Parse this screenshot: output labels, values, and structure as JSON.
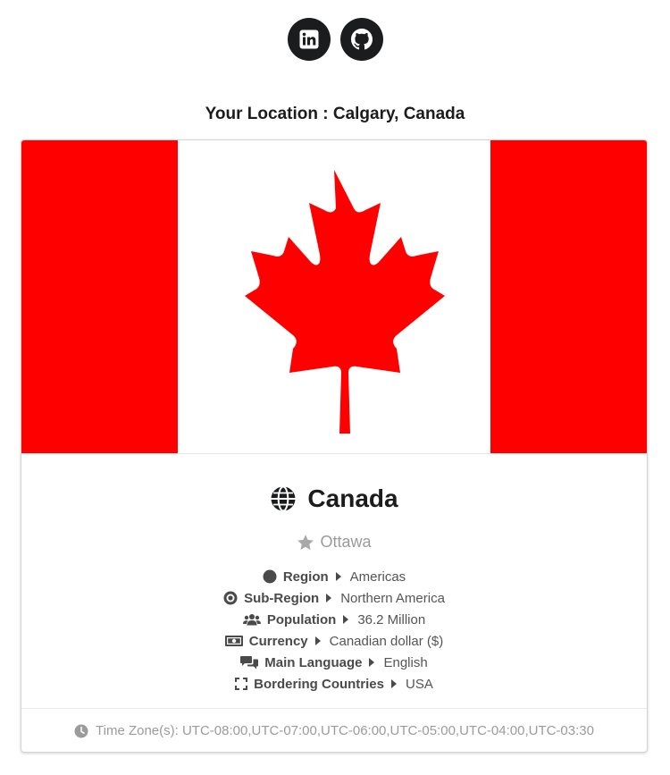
{
  "social": {
    "linkedin_icon": "linkedin-icon",
    "github_icon": "github-icon"
  },
  "location": {
    "text": "Your Location : Calgary, Canada"
  },
  "country": {
    "name": "Canada",
    "capital": "Ottawa",
    "flag_colors": {
      "red": "#ff0000",
      "white": "#ffffff"
    }
  },
  "facts": [
    {
      "icon": "circle-icon",
      "label": "Region",
      "value": "Americas"
    },
    {
      "icon": "dot-circle-icon",
      "label": "Sub-Region",
      "value": "Northern America"
    },
    {
      "icon": "users-icon",
      "label": "Population",
      "value": "36.2 Million"
    },
    {
      "icon": "money-bill-icon",
      "label": "Currency",
      "value": "Canadian dollar ($)"
    },
    {
      "icon": "comments-icon",
      "label": "Main Language",
      "value": "English"
    },
    {
      "icon": "expand-icon",
      "label": "Bordering Countries",
      "value": "USA"
    }
  ],
  "footer": {
    "timezones": "Time Zone(s): UTC-08:00,UTC-07:00,UTC-06:00,UTC-05:00,UTC-04:00,UTC-03:30"
  }
}
